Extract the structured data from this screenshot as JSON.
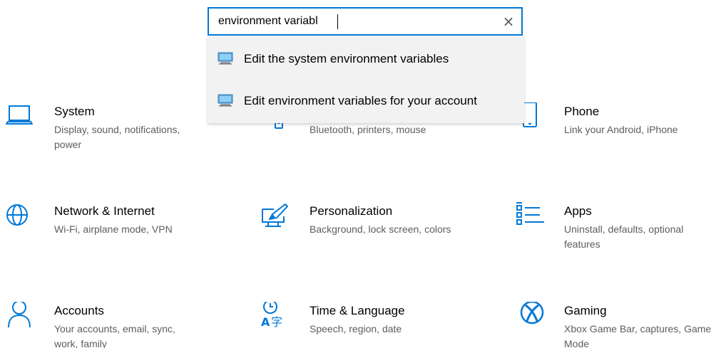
{
  "search": {
    "value": "environment variabl",
    "clear_symbol": "×",
    "suggestions": [
      {
        "label": "Edit the system environment variables",
        "icon": "computer-monitor-icon"
      },
      {
        "label": "Edit environment variables for your account",
        "icon": "computer-monitor-icon"
      }
    ]
  },
  "colors": {
    "accent": "#0078d7",
    "description": "#5d5d5d",
    "dropdown_bg": "#f2f2f2"
  },
  "tiles": [
    {
      "title": "System",
      "description": "Display, sound, notifications, power",
      "icon": "laptop-icon"
    },
    {
      "title": "",
      "description": "Bluetooth, printers, mouse",
      "icon": "devices-icon"
    },
    {
      "title": "Phone",
      "description": "Link your Android, iPhone",
      "icon": "phone-icon"
    },
    {
      "title": "Network & Internet",
      "description": "Wi-Fi, airplane mode, VPN",
      "icon": "globe-icon"
    },
    {
      "title": "Personalization",
      "description": "Background, lock screen, colors",
      "icon": "paint-brush-icon"
    },
    {
      "title": "Apps",
      "description": "Uninstall, defaults, optional features",
      "icon": "apps-list-icon"
    },
    {
      "title": "Accounts",
      "description": "Your accounts, email, sync, work, family",
      "icon": "person-icon"
    },
    {
      "title": "Time & Language",
      "description": "Speech, region, date",
      "icon": "time-language-icon"
    },
    {
      "title": "Gaming",
      "description": "Xbox Game Bar, captures, Game Mode",
      "icon": "xbox-icon"
    }
  ]
}
